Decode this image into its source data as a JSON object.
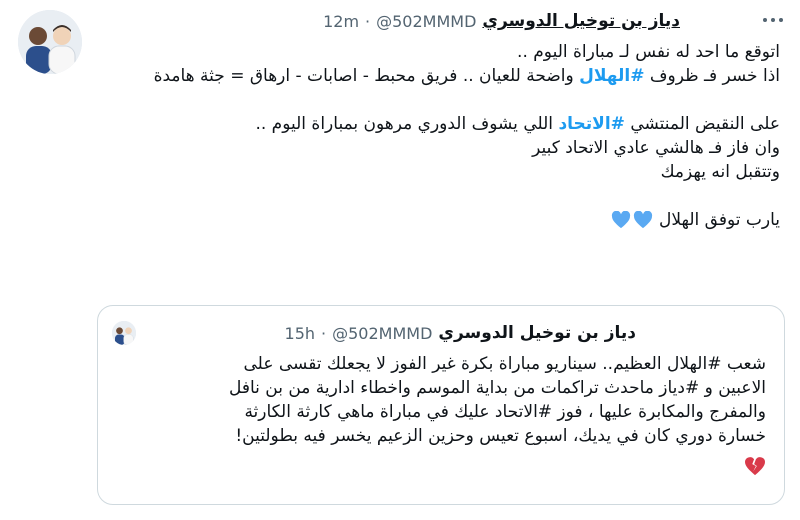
{
  "tweet": {
    "display_name": "دياز بن توخيل الدوسري",
    "handle": "@502MMMD",
    "separator": "·",
    "time": "12m",
    "lines": [
      [
        "اتوقع ما احد له نفس لـ مباراة اليوم .."
      ],
      [
        "اذا خسر فـ ظروف ",
        "#الهلال",
        " واضحة للعيان .. فريق محبط - اصابات - ارهاق = جثة هامدة"
      ],
      [],
      [
        "على النقيض المنتشي ",
        "#الاتحاد",
        " اللي يشوف الدوري مرهون بمباراة اليوم .."
      ],
      [
        "وان فاز فـ هالشي عادي الاتحاد كبير"
      ],
      [
        "وتتقبل انه يهزمك"
      ],
      [],
      [
        "يارب توفق الهلال"
      ]
    ],
    "line_1": "اتوقع ما احد له نفس لـ مباراة اليوم ..",
    "line_2_pre": "اذا خسر فـ ظروف",
    "line_2_tag": "#الهلال",
    "line_2_post": "واضحة للعيان .. فريق محبط - اصابات - ارهاق = جثة هامدة",
    "line_3_pre": "على النقيض المنتشي",
    "line_3_tag": "#الاتحاد",
    "line_3_post": "اللي يشوف الدوري مرهون بمباراة اليوم ..",
    "line_4": "وان فاز فـ هالشي عادي الاتحاد كبير",
    "line_5": "وتتقبل انه يهزمك",
    "line_6": "يارب توفق الهلال",
    "heart_icons": [
      "blue-heart-icon",
      "blue-heart-icon"
    ]
  },
  "quoted": {
    "display_name": "دياز بن توخيل الدوسري",
    "handle": "@502MMMD",
    "separator": "·",
    "time": "15h",
    "line_1": "شعب #الهلال العظيم.. سيناريو مباراة بكرة غير الفوز لا يجعلك تقسى على",
    "line_2": "الاعبين و #دياز ماحدث تراكمات من بداية الموسم واخطاء ادارية من بن نافل",
    "line_3": "والمفرج والمكابرة عليها ، فوز #الاتحاد عليك في مباراة ماهي كارثة الكارثة",
    "line_4": "خسارة دوري كان في يديك، اسبوع تعيس وحزين الزعيم يخسر فيه بطولتين!",
    "trailing_icon": "broken-heart-icon"
  },
  "colors": {
    "hashtag": "#1d9bf0",
    "heart": "#5aa9f2",
    "broken_heart": "#d93a4a",
    "muted": "#536471",
    "border": "#cfd9de"
  }
}
